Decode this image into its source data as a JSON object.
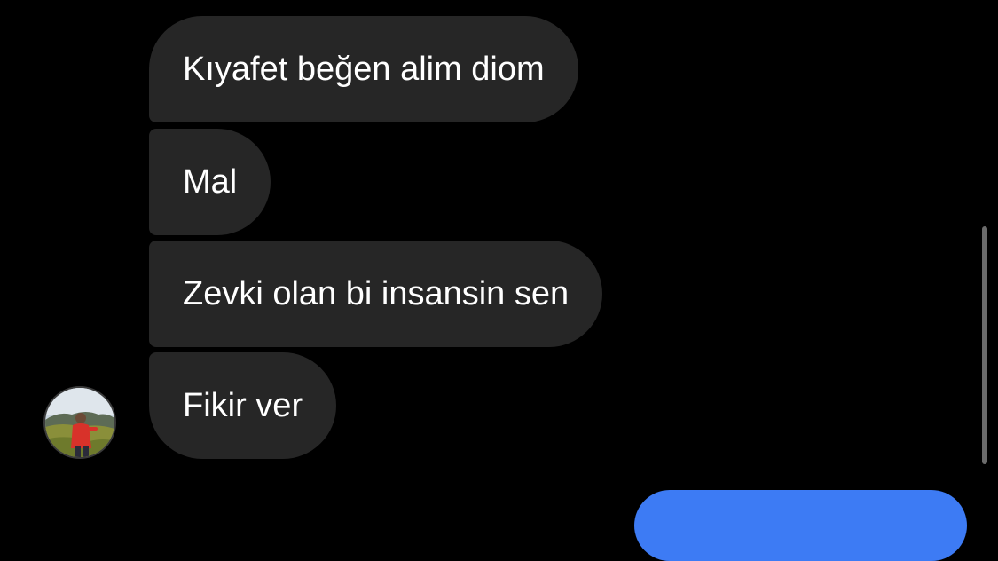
{
  "conversation": {
    "received_messages": [
      {
        "text": "Kıyafet beğen alim diom"
      },
      {
        "text": "Mal"
      },
      {
        "text": "Zevki olan bi insansin sen"
      },
      {
        "text": "Fikir ver"
      }
    ]
  },
  "theme": {
    "background": "#000000",
    "received_bubble": "#262626",
    "sent_bubble": "#3d7bf4",
    "text": "#ffffff",
    "scrollbar": "#6b6b6b"
  },
  "icons": {
    "avatar": "profile-photo"
  }
}
